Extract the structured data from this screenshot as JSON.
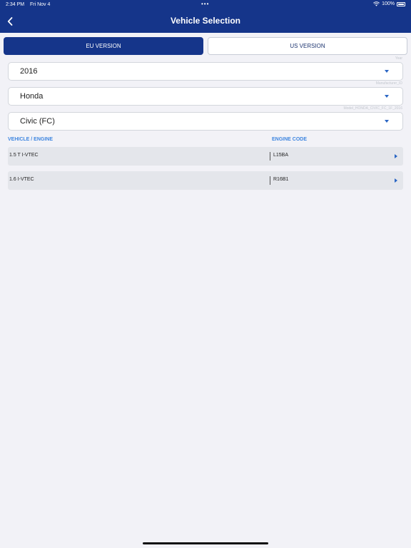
{
  "status_bar": {
    "time": "2:34 PM",
    "date": "Fri Nov 4",
    "battery": "100%",
    "dots": "•••"
  },
  "header": {
    "title": "Vehicle Selection",
    "back_icon": "chevron-left-icon"
  },
  "segment": {
    "eu_label": "EU VERSION",
    "us_label": "US VERSION",
    "selected": "EU VERSION"
  },
  "selectors": [
    {
      "value": "2016",
      "hint": "Year"
    },
    {
      "value": "Honda",
      "hint": "Manufacturer_ID"
    },
    {
      "value": "Civic (FC)",
      "hint": "Model_HONDA_CIVIC_FC_1F_2016"
    }
  ],
  "table": {
    "headers": {
      "engine": "VEHICLE / ENGINE",
      "code": "ENGINE CODE"
    },
    "rows": [
      {
        "engine": "1.5 T I-VTEC",
        "code": "L15BA"
      },
      {
        "engine": "1.6 I-VTEC",
        "code": "R16B1"
      }
    ]
  },
  "colors": {
    "header_bg": "#15358a",
    "accent": "#3f86e0",
    "background": "#f2f2f7"
  }
}
